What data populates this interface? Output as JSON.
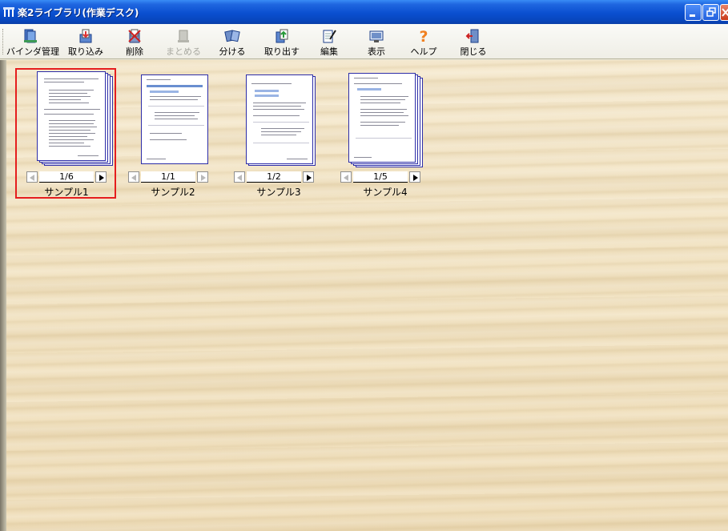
{
  "window": {
    "title": "楽2ライブラリ(作業デスク)",
    "colors": {
      "titlebar": "#0a4fd0",
      "selection": "#e51e1e",
      "desk": "#f3e5c6"
    }
  },
  "toolbar": {
    "items": [
      {
        "label": "バインダ管理",
        "icon": "binder-icon",
        "enabled": true
      },
      {
        "label": "取り込み",
        "icon": "import-icon",
        "enabled": true
      },
      {
        "label": "削除",
        "icon": "delete-icon",
        "enabled": true
      },
      {
        "label": "まとめる",
        "icon": "merge-icon",
        "enabled": false
      },
      {
        "label": "分ける",
        "icon": "split-icon",
        "enabled": true
      },
      {
        "label": "取り出す",
        "icon": "extract-icon",
        "enabled": true
      },
      {
        "label": "編集",
        "icon": "edit-icon",
        "enabled": true
      },
      {
        "label": "表示",
        "icon": "view-icon",
        "enabled": true
      },
      {
        "label": "ヘルプ",
        "icon": "help-icon",
        "enabled": true
      },
      {
        "label": "閉じる",
        "icon": "close-door-icon",
        "enabled": true
      }
    ]
  },
  "books": [
    {
      "name": "サンプル1",
      "page": "1/6",
      "selected": true,
      "stacked": true
    },
    {
      "name": "サンプル2",
      "page": "1/1",
      "selected": false,
      "stacked": false
    },
    {
      "name": "サンプル3",
      "page": "1/2",
      "selected": false,
      "stacked": false
    },
    {
      "name": "サンプル4",
      "page": "1/5",
      "selected": false,
      "stacked": true
    }
  ]
}
